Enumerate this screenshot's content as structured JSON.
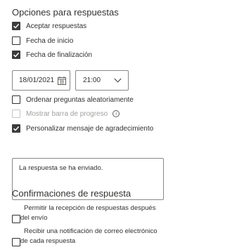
{
  "response_options": {
    "title": "Opciones para respuestas",
    "accept_responses": {
      "label": "Aceptar respuestas",
      "checked": true
    },
    "start_date": {
      "label": "Fecha de inicio",
      "checked": false
    },
    "end_date": {
      "label": "Fecha de finalización",
      "checked": true
    },
    "date_value": "18/01/2021",
    "time_value": "21:00",
    "shuffle_questions": {
      "label": "Ordenar preguntas aleatoriamente",
      "checked": false
    },
    "show_progress_bar": {
      "label": "Mostrar barra de progreso",
      "checked": false,
      "disabled": true
    },
    "custom_thank_you": {
      "label": "Personalizar mensaje de agradecimiento",
      "checked": true
    },
    "thank_you_message": "La respuesta se ha enviado."
  },
  "response_receipts": {
    "title": "Confirmaciones de respuesta",
    "send_receipt": {
      "line1": "Permitir la recepción de respuestas después",
      "line2": "del envío",
      "checked": false
    },
    "notify_email": {
      "line1": "Recibir una notificación de correo electrónico",
      "line2": "de cada respuesta",
      "checked": false
    }
  },
  "icons": {
    "checkmark": "checkmark-icon",
    "calendar": "calendar-icon",
    "chevron": "chevron-down-icon",
    "info": "info-icon"
  },
  "colors": {
    "checked_fill": "#3c3c3c",
    "border": "#8a8886",
    "text": "#323130",
    "disabled_text": "#a19f9d"
  }
}
